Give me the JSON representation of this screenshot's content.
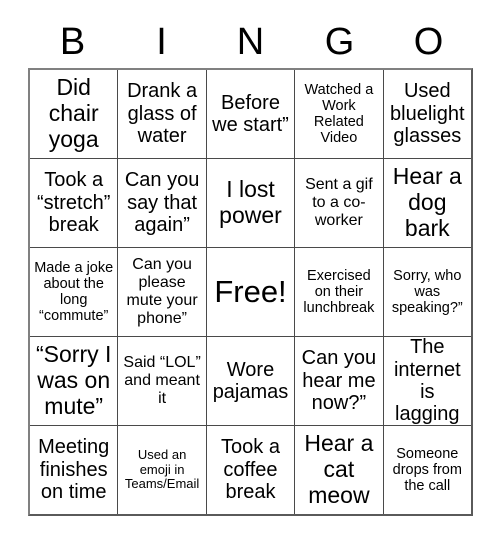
{
  "card": {
    "title": "BINGO",
    "background_color": "#ffffff",
    "text_color": "#000000",
    "border_color": "#4a4a4a",
    "columns": 5,
    "rows": 5
  },
  "header": {
    "letters": [
      "B",
      "I",
      "N",
      "G",
      "O"
    ]
  },
  "grid": {
    "cells": [
      {
        "text": "Did chair yoga",
        "size": "lg",
        "free": false
      },
      {
        "text": "Drank a glass of water",
        "size": "md",
        "free": false
      },
      {
        "text": "Before we start”",
        "size": "md",
        "free": false
      },
      {
        "text": "Watched a Work Related Video",
        "size": "xs",
        "free": false
      },
      {
        "text": "Used bluelight glasses",
        "size": "md",
        "free": false
      },
      {
        "text": "Took a “stretch” break",
        "size": "md",
        "free": false
      },
      {
        "text": "Can you say that again”",
        "size": "md",
        "free": false
      },
      {
        "text": "I lost power",
        "size": "lg",
        "free": false
      },
      {
        "text": "Sent a gif to a co-worker",
        "size": "sm",
        "free": false
      },
      {
        "text": "Hear a dog bark",
        "size": "lg",
        "free": false
      },
      {
        "text": "Made a joke about the long “commute”",
        "size": "xs",
        "free": false
      },
      {
        "text": "Can you please mute your phone”",
        "size": "sm",
        "free": false
      },
      {
        "text": "Free!",
        "size": "xl",
        "free": true
      },
      {
        "text": "Exercised on their lunchbreak",
        "size": "xs",
        "free": false
      },
      {
        "text": "Sorry, who was speaking?”",
        "size": "xs",
        "free": false
      },
      {
        "text": "“Sorry I was on mute”",
        "size": "lg",
        "free": false
      },
      {
        "text": "Said “LOL” and meant it",
        "size": "sm",
        "free": false
      },
      {
        "text": "Wore pajamas",
        "size": "md",
        "free": false
      },
      {
        "text": "Can you hear me now?”",
        "size": "md",
        "free": false
      },
      {
        "text": "The internet is lagging",
        "size": "md",
        "free": false
      },
      {
        "text": "Meeting finishes on time",
        "size": "md",
        "free": false
      },
      {
        "text": "Used an emoji in Teams/Email",
        "size": "xxs",
        "free": false
      },
      {
        "text": "Took a coffee break",
        "size": "md",
        "free": false
      },
      {
        "text": "Hear a cat meow",
        "size": "lg",
        "free": false
      },
      {
        "text": "Someone drops from the call",
        "size": "xs",
        "free": false
      }
    ]
  }
}
